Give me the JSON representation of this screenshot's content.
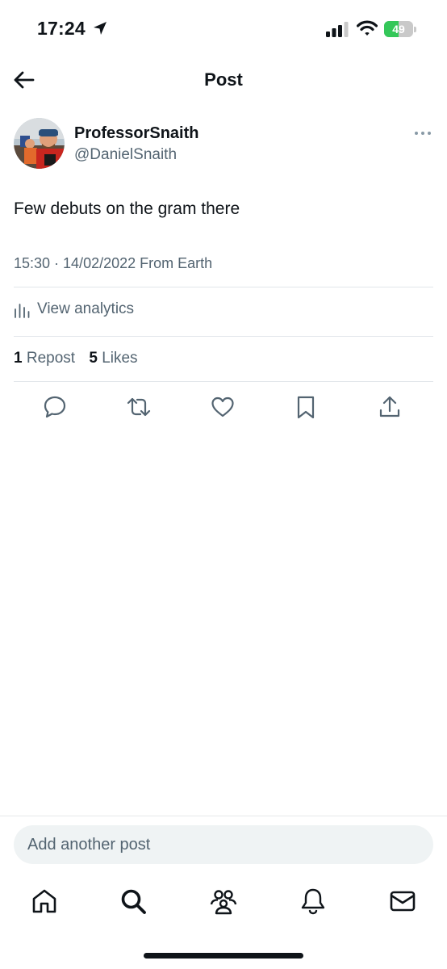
{
  "status_bar": {
    "time": "17:24",
    "battery_level": 49,
    "battery_text": "49",
    "battery_color": "#34c759",
    "icons": [
      "location-arrow-icon",
      "cellular-signal-icon",
      "wifi-icon",
      "battery-icon"
    ]
  },
  "header": {
    "title": "Post",
    "back_icon": "arrow-left-icon"
  },
  "post": {
    "author": {
      "display_name": "ProfessorSnaith",
      "handle": "@DanielSnaith"
    },
    "text": "Few debuts on the gram there",
    "meta": "15:30 · 14/02/2022 From Earth",
    "analytics_label": "View analytics",
    "stats": {
      "reposts_count": "1",
      "reposts_label": "Repost",
      "likes_count": "5",
      "likes_label": "Likes"
    },
    "actions": [
      "reply-icon",
      "repost-icon",
      "like-icon",
      "bookmark-icon",
      "share-icon"
    ]
  },
  "reply": {
    "placeholder": "Add another post"
  },
  "tab_bar": {
    "tabs": [
      "home-icon",
      "search-icon",
      "communities-icon",
      "notifications-icon",
      "messages-icon"
    ]
  },
  "colors": {
    "text_primary": "#0f1419",
    "text_secondary": "#536471",
    "divider": "#e1e6ea",
    "input_bg": "#eff3f4"
  }
}
